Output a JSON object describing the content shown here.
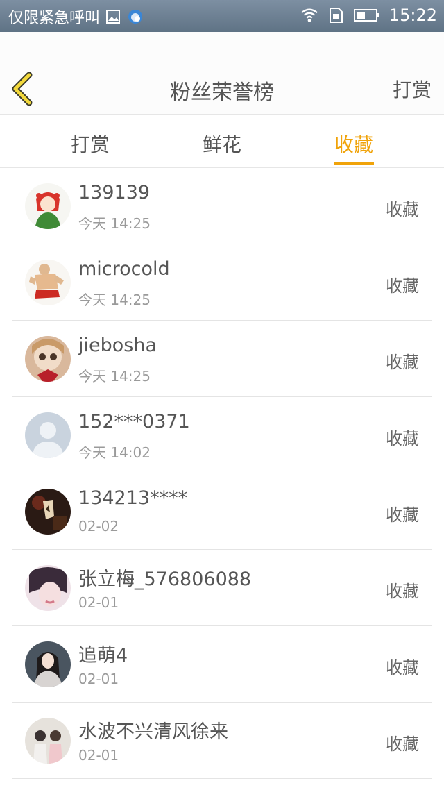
{
  "status_bar": {
    "left_text": "仅限紧急呼叫",
    "time": "15:22",
    "icons": [
      "image-icon",
      "cloud-icon",
      "wifi-icon",
      "sim-icon",
      "battery-icon"
    ]
  },
  "header": {
    "title": "粉丝荣誉榜",
    "action": "打赏",
    "back_icon": "chevron-left-icon"
  },
  "tabs": [
    {
      "label": "打赏",
      "active": false
    },
    {
      "label": "鲜花",
      "active": false
    },
    {
      "label": "收藏",
      "active": true
    }
  ],
  "colors": {
    "accent": "#f0a30a",
    "status_bar": "#6b7f92",
    "text": "#555555",
    "subtext": "#9a9a9a"
  },
  "fans": [
    {
      "name": "139139",
      "time": "今天 14:25",
      "action": "收藏",
      "avatar": "anime-girl-avatar"
    },
    {
      "name": "microcold",
      "time": "今天 14:25",
      "action": "收藏",
      "avatar": "anime-man-avatar"
    },
    {
      "name": "jiebosha",
      "time": "今天 14:25",
      "action": "收藏",
      "avatar": "doll-avatar"
    },
    {
      "name": "152***0371",
      "time": "今天 14:02",
      "action": "收藏",
      "avatar": "default-avatar"
    },
    {
      "name": "134213****",
      "time": "02-02",
      "action": "收藏",
      "avatar": "dark-photo-avatar"
    },
    {
      "name": "张立梅_576806088",
      "time": "02-01",
      "action": "收藏",
      "avatar": "girl-photo-avatar"
    },
    {
      "name": "追萌4",
      "time": "02-01",
      "action": "收藏",
      "avatar": "girl-portrait-avatar"
    },
    {
      "name": "水波不兴清风徐来",
      "time": "02-01",
      "action": "收藏",
      "avatar": "couple-photo-avatar"
    }
  ]
}
